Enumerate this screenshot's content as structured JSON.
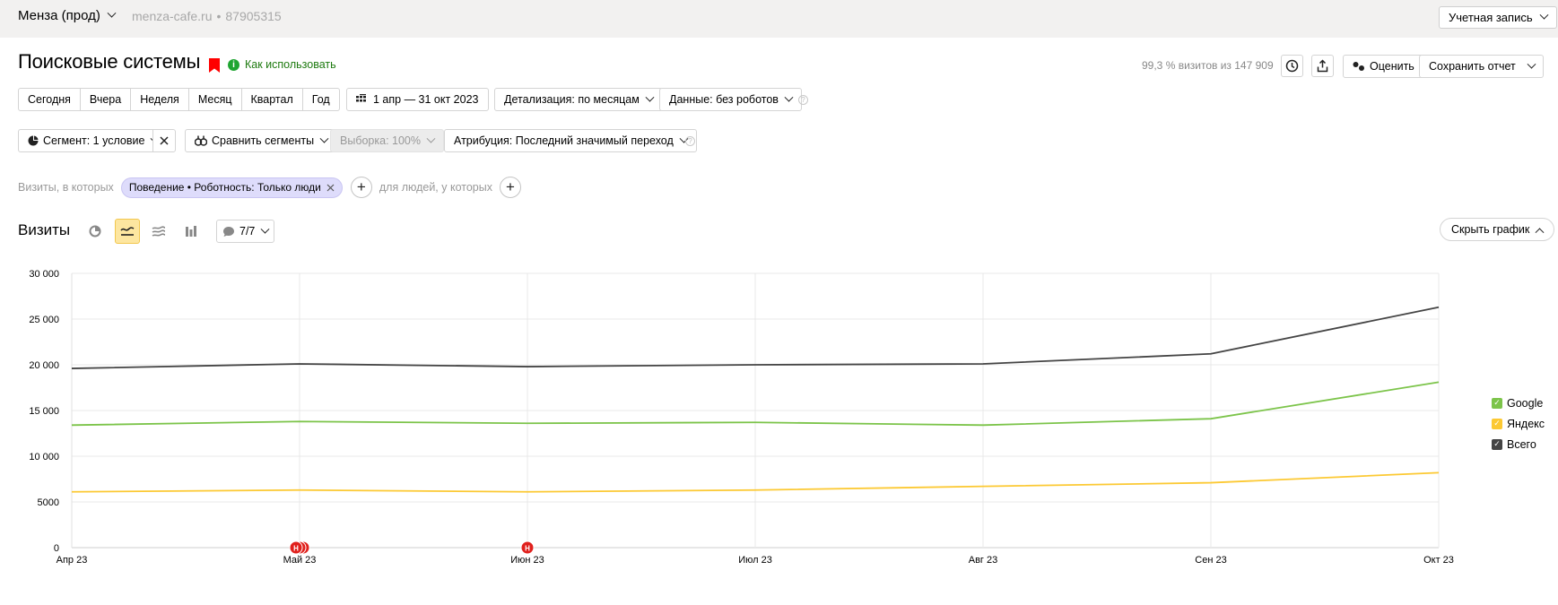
{
  "topbar": {
    "counter": "Менза (прод)",
    "site": "menza-cafe.ru",
    "counter_id": "87905315",
    "account": "Учетная запись"
  },
  "report": {
    "title": "Поисковые системы",
    "howto": "Как использовать",
    "visits_share": "99,3 % визитов из 147 909",
    "rate_label": "Оценить",
    "save_label": "Сохранить отчет"
  },
  "period": {
    "buttons": [
      "Сегодня",
      "Вчера",
      "Неделя",
      "Месяц",
      "Квартал",
      "Год"
    ],
    "range": "1 апр — 31 окт 2023",
    "detail": "Детализация: по месяцам",
    "data": "Данные: без роботов"
  },
  "segments": {
    "segment": "Сегмент: 1 условие",
    "compare": "Сравнить сегменты",
    "sample": "Выборка: 100%",
    "attribution": "Атрибуция: Последний значимый переход"
  },
  "filter": {
    "visits_label": "Визиты, в которых",
    "chip": "Поведение • Роботность: Только люди",
    "people_label": "для людей, у которых"
  },
  "chart_panel": {
    "metric": "Визиты",
    "notes": "7/7",
    "hide": "Скрыть график",
    "note_marker": "Н"
  },
  "colors": {
    "google": "#7cc44a",
    "yandex": "#fcc933",
    "total": "#444444",
    "accent_red": "#e0201c"
  },
  "chart_data": {
    "type": "line",
    "x": [
      "Апр 23",
      "Май 23",
      "Июн 23",
      "Июл 23",
      "Авг 23",
      "Сен 23",
      "Окт 23"
    ],
    "y_ticks": [
      "0",
      "5000",
      "10 000",
      "15 000",
      "20 000",
      "25 000",
      "30 000"
    ],
    "ylim": [
      0,
      30000
    ],
    "grid": true,
    "legend_position": "right",
    "series": [
      {
        "name": "Google",
        "values": [
          13400,
          13800,
          13600,
          13700,
          13400,
          14100,
          18100
        ]
      },
      {
        "name": "Яндекс",
        "values": [
          6100,
          6300,
          6100,
          6300,
          6700,
          7100,
          8200
        ]
      },
      {
        "name": "Всего",
        "values": [
          19600,
          20100,
          19800,
          20000,
          20100,
          21200,
          26300
        ]
      }
    ],
    "notes_at": [
      "Май 23",
      "Июн 23"
    ]
  }
}
